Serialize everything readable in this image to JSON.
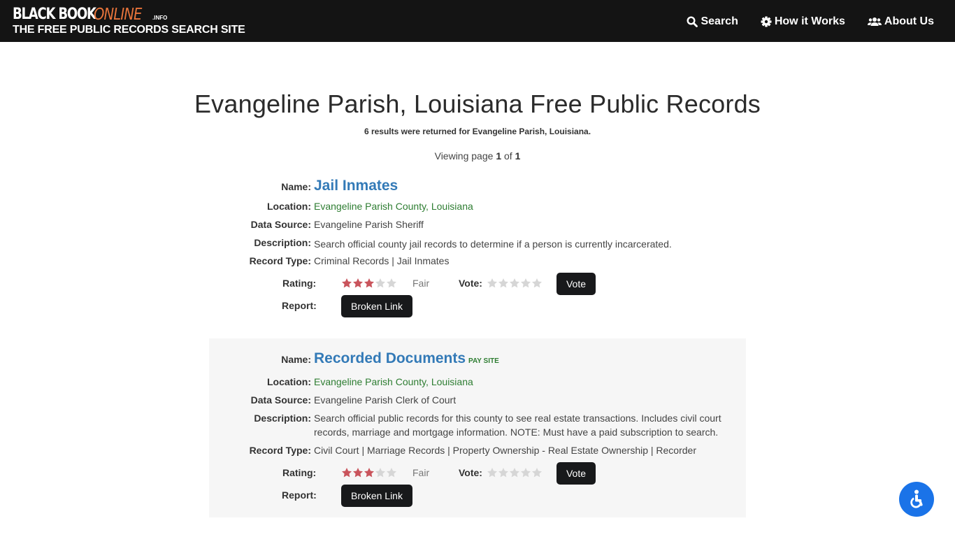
{
  "header": {
    "logo_black": "BLACK BOOK",
    "logo_online": "ONLINE",
    "logo_info": ".INFO",
    "tagline": "THE FREE PUBLIC RECORDS SEARCH SITE",
    "nav": [
      {
        "label": "Search",
        "icon": "search-icon"
      },
      {
        "label": "How it Works",
        "icon": "gear-icon"
      },
      {
        "label": "About Us",
        "icon": "users-icon"
      }
    ]
  },
  "page": {
    "title": "Evangeline Parish, Louisiana Free Public Records",
    "results_text": "6 results were returned for Evangeline Parish, Louisiana.",
    "paging_prefix": "Viewing page ",
    "current_page": "1",
    "paging_mid": " of ",
    "total_pages": "1"
  },
  "labels": {
    "name": "Name:",
    "location": "Location:",
    "data_source": "Data Source:",
    "description": "Description:",
    "record_type": "Record Type:",
    "rating": "Rating:",
    "vote": "Vote:",
    "report": "Report:",
    "vote_button": "Vote",
    "broken_link_button": "Broken Link"
  },
  "records": [
    {
      "name": "Jail Inmates",
      "pay_site": "",
      "location": "Evangeline Parish County, Louisiana",
      "data_source": "Evangeline Parish Sheriff",
      "description": "Search official county jail records to determine if a person is currently incarcerated.",
      "record_type": "Criminal Records | Jail Inmates",
      "rating_stars": 3,
      "rating_max": 5,
      "rating_text": "Fair"
    },
    {
      "name": "Recorded Documents",
      "pay_site": "PAY SITE",
      "location": "Evangeline Parish County, Louisiana",
      "data_source": "Evangeline Parish Clerk of Court",
      "description": "Search official public records for this county to see real estate transactions. Includes civil court records, marriage and mortgage information. NOTE: Must have a paid subscription to search.",
      "record_type": "Civil Court | Marriage Records | Property Ownership - Real Estate Ownership | Recorder",
      "rating_stars": 3,
      "rating_max": 5,
      "rating_text": "Fair"
    }
  ],
  "colors": {
    "header_bg": "#141414",
    "accent_orange": "#e8743b",
    "link_blue": "#337ab7",
    "location_green": "#2e7d32",
    "star_filled": "#c9545c",
    "star_empty": "#d6d6d6",
    "accessibility_blue": "#1a73e8"
  },
  "accessibility": {
    "icon": "wheelchair-icon"
  }
}
